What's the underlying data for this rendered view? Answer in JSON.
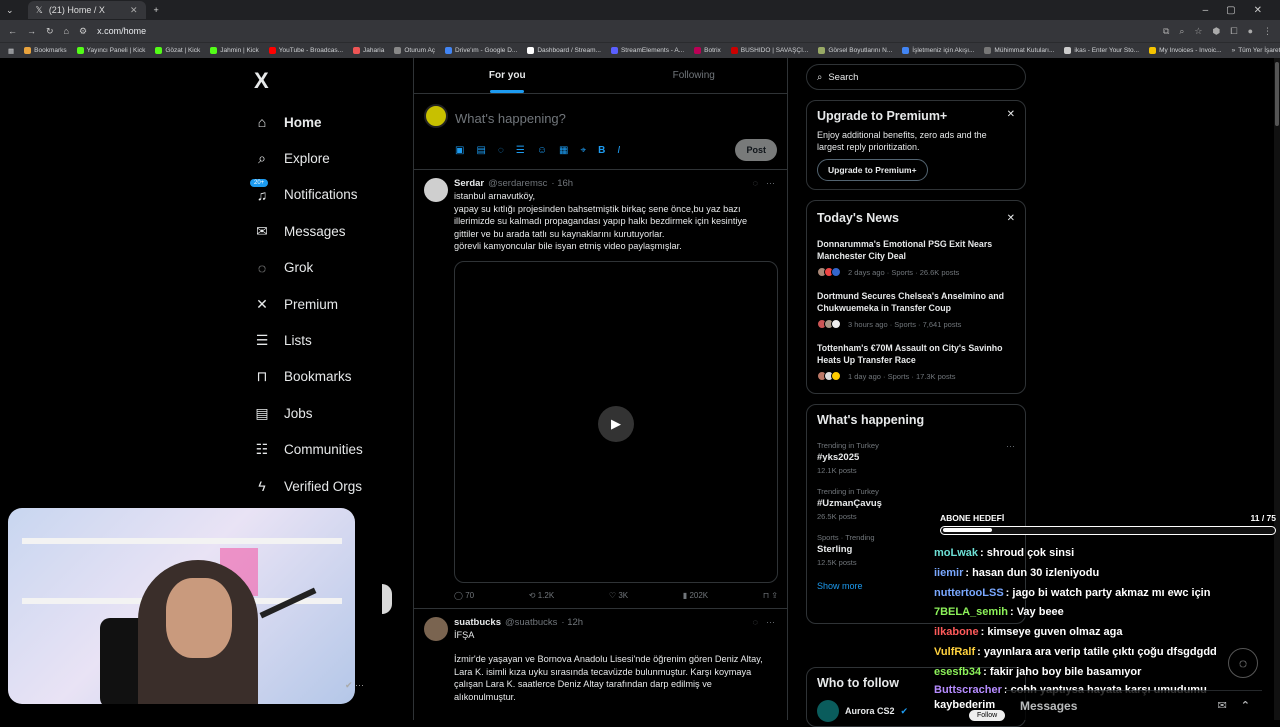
{
  "browser": {
    "tab_title": "(21) Home / X",
    "url": "x.com/home",
    "bookmarks": [
      "Bookmarks",
      "Yayıncı Paneli | Kick",
      "Gözat | Kick",
      "Jahmin | Kick",
      "YouTube - Broadcas...",
      "Jaharia",
      "Oturum Aç",
      "Drive'ım - Google D...",
      "Dashboard / Stream...",
      "StreamElements - A...",
      "Botrix",
      "BUSHIDO | SAVAŞÇI...",
      "Görsel Boyutlarını N...",
      "İşletmeniz için Akışı...",
      "Mühimmat Kutuları...",
      "ikas - Enter Your Sto...",
      "My Invoices - Invoic..."
    ],
    "bookmarks_right": "Tüm Yer İşaretleri"
  },
  "nav": {
    "logo": "X",
    "notif_badge": "20+",
    "items": [
      {
        "label": "Home",
        "icon": "home-icon"
      },
      {
        "label": "Explore",
        "icon": "search-icon"
      },
      {
        "label": "Notifications",
        "icon": "bell-icon"
      },
      {
        "label": "Messages",
        "icon": "mail-icon"
      },
      {
        "label": "Grok",
        "icon": "grok-icon"
      },
      {
        "label": "Premium",
        "icon": "x-icon"
      },
      {
        "label": "Lists",
        "icon": "list-icon"
      },
      {
        "label": "Bookmarks",
        "icon": "bookmark-icon"
      },
      {
        "label": "Jobs",
        "icon": "briefcase-icon"
      },
      {
        "label": "Communities",
        "icon": "people-icon"
      },
      {
        "label": "Verified Orgs",
        "icon": "bolt-icon"
      }
    ]
  },
  "feed": {
    "tabs": [
      "For you",
      "Following"
    ],
    "composer_placeholder": "What's happening?",
    "post_label": "Post",
    "tweets": [
      {
        "name": "Serdar",
        "handle": "@serdaremsc",
        "time": "· 16h",
        "lines": [
          "istanbul arnavutköy,",
          "yapay su kıtlığı projesinden bahsetmiştik birkaç sene önce,bu yaz bazı",
          "illerimizde su kalmadı propagandası yapıp halkı bezdirmek için kesintiye",
          "gittiler ve bu arada tatlı su kaynaklarını kurutuyorlar.",
          "görevli kamyoncular bile isyan etmiş video paylaşmışlar."
        ],
        "stats": {
          "replies": "70",
          "reposts": "1.2K",
          "likes": "3K",
          "views": "202K"
        }
      },
      {
        "name": "suatbucks",
        "handle": "@suatbucks",
        "time": "· 12h",
        "lines": [
          "İFŞA",
          "",
          "İzmir'de yaşayan ve Bornova Anadolu Lisesi'nde öğrenim gören Deniz Altay,",
          "Lara K. isimli kıza uyku sırasında tecavüzde bulunmuştur. Karşı koymaya",
          "çalışan Lara K. saatlerce Deniz Altay tarafından darp edilmiş ve",
          "alıkonulmuştur."
        ]
      }
    ]
  },
  "right": {
    "search_placeholder": "Search",
    "premium": {
      "title": "Upgrade to Premium+",
      "desc": "Enjoy additional benefits, zero ads and the largest reply prioritization.",
      "button": "Upgrade to Premium+"
    },
    "news": {
      "title": "Today's News",
      "items": [
        {
          "title": "Donnarumma's Emotional PSG Exit Nears Manchester City Deal",
          "meta": "2 days ago · Sports · 26.6K posts"
        },
        {
          "title": "Dortmund Secures Chelsea's Anselmino and Chukwuemeka in Transfer Coup",
          "meta": "3 hours ago · Sports · 7,641 posts"
        },
        {
          "title": "Tottenham's €70M Assault on City's Savinho Heats Up Transfer Race",
          "meta": "1 day ago · Sports · 17.3K posts"
        }
      ]
    },
    "happening": {
      "title": "What's happening",
      "items": [
        {
          "cat": "Trending in Turkey",
          "tag": "#yks2025",
          "count": "12.1K posts"
        },
        {
          "cat": "Trending in Turkey",
          "tag": "#UzmanÇavuş",
          "count": "26.5K posts"
        },
        {
          "cat": "Sports · Trending",
          "tag": "Sterling",
          "count": "12.5K posts"
        }
      ],
      "show_more": "Show more"
    },
    "who_follow": {
      "title": "Who to follow",
      "account": "Aurora CS2",
      "follow": "Follow"
    }
  },
  "stream": {
    "goal_label": "ABONE HEDEFİ",
    "goal_count": "11",
    "goal_total": "/ 75",
    "goal_fraction": 0.147,
    "messages": [
      {
        "user": "moLwak",
        "text": ": shroud çok sinsi",
        "color": "#6ee0d6"
      },
      {
        "user": "iiemir",
        "text": ": hasan dun 30 izleniyodu",
        "color": "#7aa8ff"
      },
      {
        "user": "nuttertooLSS",
        "text": ": jago bi watch party akmaz mı ewc için",
        "color": "#7aa8ff"
      },
      {
        "user": "7BELA_semih",
        "text": ": Vay beee",
        "color": "#8df25a"
      },
      {
        "user": "ilkabone",
        "text": ": kimseye guven olmaz aga",
        "color": "#ff5a5a"
      },
      {
        "user": "VulfRalf",
        "text": ": yayınlara ara verip tatile çıktı çoğu dfsgdgdd",
        "color": "#ffd23f"
      },
      {
        "user": "esesfb34",
        "text": ": fakir jaho boy bile basamıyor",
        "color": "#8df25a"
      },
      {
        "user": "Buttscracher",
        "text": ": cohh yaptıysa hayata karşı umudumu kaybederim",
        "color": "#b68cff"
      }
    ],
    "drawer_label": "Messages"
  }
}
